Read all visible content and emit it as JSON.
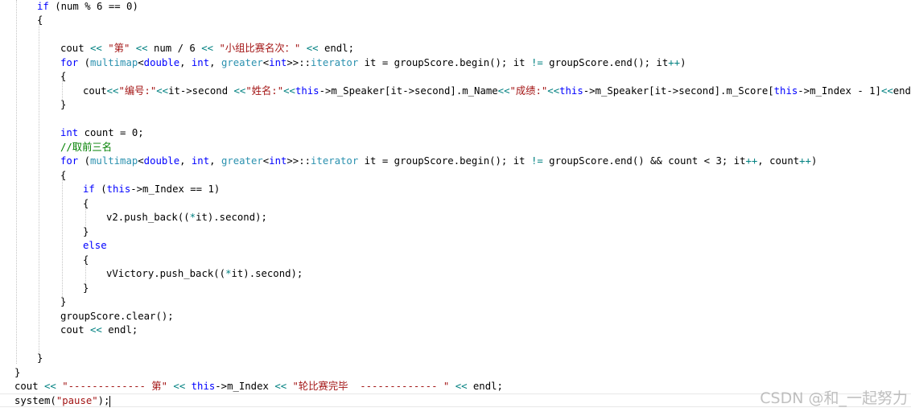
{
  "lines": [
    [
      {
        "t": "if",
        "c": "k"
      },
      {
        "t": " (num % 6 == 0)"
      }
    ],
    [
      {
        "t": "{"
      }
    ],
    [],
    [
      {
        "t": "cout "
      },
      {
        "t": "<<",
        "c": "o"
      },
      {
        "t": " "
      },
      {
        "t": "\"第\"",
        "c": "s"
      },
      {
        "t": " "
      },
      {
        "t": "<<",
        "c": "o"
      },
      {
        "t": " num / 6 "
      },
      {
        "t": "<<",
        "c": "o"
      },
      {
        "t": " "
      },
      {
        "t": "\"小组比赛名次：\"",
        "c": "s"
      },
      {
        "t": " "
      },
      {
        "t": "<<",
        "c": "o"
      },
      {
        "t": " endl;"
      }
    ],
    [
      {
        "t": "for",
        "c": "k"
      },
      {
        "t": " ("
      },
      {
        "t": "multimap",
        "c": "t"
      },
      {
        "t": "<"
      },
      {
        "t": "double",
        "c": "k"
      },
      {
        "t": ", "
      },
      {
        "t": "int",
        "c": "k"
      },
      {
        "t": ", "
      },
      {
        "t": "greater",
        "c": "t"
      },
      {
        "t": "<"
      },
      {
        "t": "int",
        "c": "k"
      },
      {
        "t": ">>::"
      },
      {
        "t": "iterator",
        "c": "t"
      },
      {
        "t": " it = groupScore.begin(); it "
      },
      {
        "t": "!=",
        "c": "o"
      },
      {
        "t": " groupScore.end(); it"
      },
      {
        "t": "++",
        "c": "o"
      },
      {
        "t": ")"
      }
    ],
    [
      {
        "t": "{"
      }
    ],
    [
      {
        "t": "cout"
      },
      {
        "t": "<<",
        "c": "o"
      },
      {
        "t": "\"编号:\"",
        "c": "s"
      },
      {
        "t": "<<",
        "c": "o"
      },
      {
        "t": "it->second "
      },
      {
        "t": "<<",
        "c": "o"
      },
      {
        "t": "\"姓名:\"",
        "c": "s"
      },
      {
        "t": "<<",
        "c": "o"
      },
      {
        "t": "this",
        "c": "k"
      },
      {
        "t": "->m_Speaker[it->second].m_Name"
      },
      {
        "t": "<<",
        "c": "o"
      },
      {
        "t": "\"成绩:\"",
        "c": "s"
      },
      {
        "t": "<<",
        "c": "o"
      },
      {
        "t": "this",
        "c": "k"
      },
      {
        "t": "->m_Speaker[it->second].m_Score["
      },
      {
        "t": "this",
        "c": "k"
      },
      {
        "t": "->m_Index - 1]"
      },
      {
        "t": "<<",
        "c": "o"
      },
      {
        "t": "endl;"
      }
    ],
    [
      {
        "t": "}"
      }
    ],
    [],
    [
      {
        "t": "int",
        "c": "k"
      },
      {
        "t": " count = 0;"
      }
    ],
    [
      {
        "t": "//取前三名",
        "c": "c"
      }
    ],
    [
      {
        "t": "for",
        "c": "k"
      },
      {
        "t": " ("
      },
      {
        "t": "multimap",
        "c": "t"
      },
      {
        "t": "<"
      },
      {
        "t": "double",
        "c": "k"
      },
      {
        "t": ", "
      },
      {
        "t": "int",
        "c": "k"
      },
      {
        "t": ", "
      },
      {
        "t": "greater",
        "c": "t"
      },
      {
        "t": "<"
      },
      {
        "t": "int",
        "c": "k"
      },
      {
        "t": ">>::"
      },
      {
        "t": "iterator",
        "c": "t"
      },
      {
        "t": " it = groupScore.begin(); it "
      },
      {
        "t": "!=",
        "c": "o"
      },
      {
        "t": " groupScore.end() && count < 3; it"
      },
      {
        "t": "++",
        "c": "o"
      },
      {
        "t": ", count"
      },
      {
        "t": "++",
        "c": "o"
      },
      {
        "t": ")"
      }
    ],
    [
      {
        "t": "{"
      }
    ],
    [
      {
        "t": "if",
        "c": "k"
      },
      {
        "t": " ("
      },
      {
        "t": "this",
        "c": "k"
      },
      {
        "t": "->m_Index == 1)"
      }
    ],
    [
      {
        "t": "{"
      }
    ],
    [
      {
        "t": "v2.push_back(("
      },
      {
        "t": "*",
        "c": "o"
      },
      {
        "t": "it).second);"
      }
    ],
    [
      {
        "t": "}"
      }
    ],
    [
      {
        "t": "else",
        "c": "k"
      }
    ],
    [
      {
        "t": "{"
      }
    ],
    [
      {
        "t": "vVictory.push_back(("
      },
      {
        "t": "*",
        "c": "o"
      },
      {
        "t": "it).second);"
      }
    ],
    [
      {
        "t": "}"
      }
    ],
    [
      {
        "t": "}"
      }
    ],
    [
      {
        "t": "groupScore.clear();"
      }
    ],
    [
      {
        "t": "cout "
      },
      {
        "t": "<<",
        "c": "o"
      },
      {
        "t": " endl;"
      }
    ],
    [],
    [
      {
        "t": "}"
      }
    ],
    [
      {
        "t": "}"
      }
    ],
    [
      {
        "t": "cout "
      },
      {
        "t": "<<",
        "c": "o"
      },
      {
        "t": " "
      },
      {
        "t": "\"------------- 第\"",
        "c": "s"
      },
      {
        "t": " "
      },
      {
        "t": "<<",
        "c": "o"
      },
      {
        "t": " "
      },
      {
        "t": "this",
        "c": "k"
      },
      {
        "t": "->m_Index "
      },
      {
        "t": "<<",
        "c": "o"
      },
      {
        "t": " "
      },
      {
        "t": "\"轮比赛完毕  ------------- \"",
        "c": "s"
      },
      {
        "t": " "
      },
      {
        "t": "<<",
        "c": "o"
      },
      {
        "t": " endl;"
      }
    ],
    [
      {
        "t": "system("
      },
      {
        "t": "\"pause\"",
        "c": "s"
      },
      {
        "t": ");"
      }
    ]
  ],
  "watermark": "CSDN @和_一起努力"
}
